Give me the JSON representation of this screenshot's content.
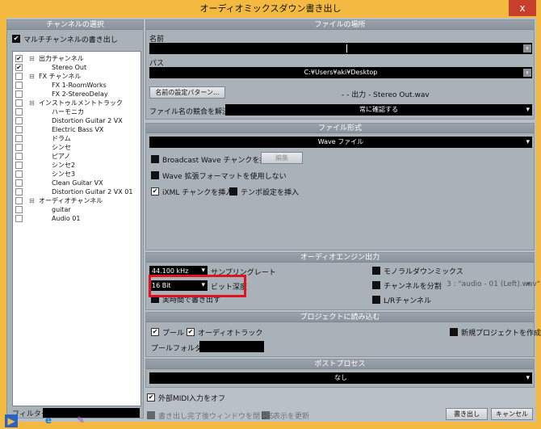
{
  "window": {
    "title": "オーディオミックスダウン書き出し",
    "close": "x"
  },
  "channels": {
    "header": "チャンネルの選択",
    "multi_label": "マルチチャンネルの書き出し",
    "filter_label": "フィルター",
    "tree": [
      {
        "label": "出力チャンネル",
        "checked": true,
        "indent": 1,
        "expand": "−"
      },
      {
        "label": "Stereo Out",
        "checked": true,
        "indent": 2,
        "expand": ""
      },
      {
        "label": "FX チャンネル",
        "checked": false,
        "indent": 1,
        "expand": "−"
      },
      {
        "label": "FX 1-RoomWorks",
        "checked": false,
        "indent": 2,
        "expand": ""
      },
      {
        "label": "FX 2-StereoDelay",
        "checked": false,
        "indent": 2,
        "expand": ""
      },
      {
        "label": "インストゥルメントトラック",
        "checked": false,
        "indent": 1,
        "expand": "−"
      },
      {
        "label": "ハーモニカ",
        "checked": false,
        "indent": 2,
        "expand": ""
      },
      {
        "label": "Distortion Guitar 2 VX",
        "checked": false,
        "indent": 2,
        "expand": ""
      },
      {
        "label": "Electric Bass VX",
        "checked": false,
        "indent": 2,
        "expand": ""
      },
      {
        "label": "ドラム",
        "checked": false,
        "indent": 2,
        "expand": ""
      },
      {
        "label": "シンセ",
        "checked": false,
        "indent": 2,
        "expand": ""
      },
      {
        "label": "ピアノ",
        "checked": false,
        "indent": 2,
        "expand": ""
      },
      {
        "label": "シンセ2",
        "checked": false,
        "indent": 2,
        "expand": ""
      },
      {
        "label": "シンセ3",
        "checked": false,
        "indent": 2,
        "expand": ""
      },
      {
        "label": "Clean Guitar VX",
        "checked": false,
        "indent": 2,
        "expand": ""
      },
      {
        "label": "Distortion Guitar 2 VX 01",
        "checked": false,
        "indent": 2,
        "expand": ""
      },
      {
        "label": "オーディオチャンネル",
        "checked": false,
        "indent": 1,
        "expand": "−"
      },
      {
        "label": "guitar",
        "checked": false,
        "indent": 2,
        "expand": ""
      },
      {
        "label": "Audio 01",
        "checked": false,
        "indent": 2,
        "expand": ""
      }
    ]
  },
  "file_location": {
    "header": "ファイルの場所",
    "name_label": "名前",
    "name_value": "",
    "path_label": "パス",
    "path_value": "C:¥Users¥aki¥Desktop",
    "naming_button": "名前の設定パターン...",
    "naming_preview": "- - 出力 - Stereo Out.wav",
    "conflict_label": "ファイル名の競合を解決",
    "conflict_value": "常に確認する"
  },
  "file_format": {
    "header": "ファイル形式",
    "format_value": "Wave ファイル",
    "broadcast_label": "Broadcast Wave チャンクを挿入",
    "edit_button": "編集",
    "no_extended_label": "Wave 拡張フォーマットを使用しない",
    "ixml_label": "iXML チャンクを挿入",
    "tempo_label": "テンポ設定を挿入"
  },
  "audio_engine": {
    "header": "オーディオエンジン出力",
    "sample_rate_value": "44.100 kHz",
    "sample_rate_label": "サンプリングレート",
    "bit_depth_value": "16 Bit",
    "bit_depth_label": "ビット深度",
    "realtime_label": "実時間で書き出す",
    "mono_label": "モノラルダウンミックス",
    "split_label": "チャンネルを分割",
    "split_info": "3 : \"audio - 01 (Left).wav\"",
    "lr_label": "L/Rチャンネル"
  },
  "import_project": {
    "header": "プロジェクトに読み込む",
    "pool_label": "プール",
    "audio_track_label": "オーディオトラック",
    "new_project_label": "新規プロジェクトを作成",
    "pool_folder_label": "プールフォルダー"
  },
  "post_process": {
    "header": "ポストプロセス",
    "value": "なし"
  },
  "footer": {
    "midi_label": "外部MIDI入力をオフ",
    "close_after_label": "書き出し完了後ウィンドウを閉じる",
    "update_label": "表示を更新",
    "export_button": "書き出し",
    "cancel_button": "キャンセル"
  },
  "colors": {
    "titlebar": "#f3b941",
    "highlight": "#e0141e"
  }
}
